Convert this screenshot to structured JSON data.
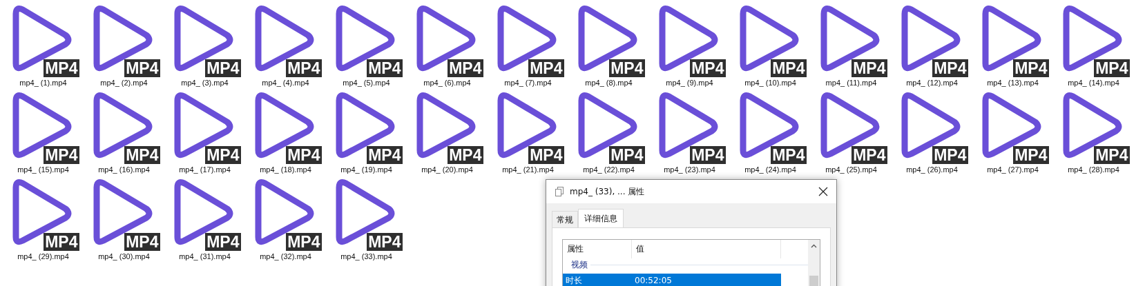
{
  "files": [
    {
      "name": "mp4_ (1).mp4",
      "badge": "MP4"
    },
    {
      "name": "mp4_ (2).mp4",
      "badge": "MP4"
    },
    {
      "name": "mp4_ (3).mp4",
      "badge": "MP4"
    },
    {
      "name": "mp4_ (4).mp4",
      "badge": "MP4"
    },
    {
      "name": "mp4_ (5).mp4",
      "badge": "MP4"
    },
    {
      "name": "mp4_ (6).mp4",
      "badge": "MP4"
    },
    {
      "name": "mp4_ (7).mp4",
      "badge": "MP4"
    },
    {
      "name": "mp4_ (8).mp4",
      "badge": "MP4"
    },
    {
      "name": "mp4_ (9).mp4",
      "badge": "MP4"
    },
    {
      "name": "mp4_ (10).mp4",
      "badge": "MP4"
    },
    {
      "name": "mp4_ (11).mp4",
      "badge": "MP4"
    },
    {
      "name": "mp4_ (12).mp4",
      "badge": "MP4"
    },
    {
      "name": "mp4_ (13).mp4",
      "badge": "MP4"
    },
    {
      "name": "mp4_ (14).mp4",
      "badge": "MP4"
    },
    {
      "name": "mp4_ (15).mp4",
      "badge": "MP4"
    },
    {
      "name": "mp4_ (16).mp4",
      "badge": "MP4"
    },
    {
      "name": "mp4_ (17).mp4",
      "badge": "MP4"
    },
    {
      "name": "mp4_ (18).mp4",
      "badge": "MP4"
    },
    {
      "name": "mp4_ (19).mp4",
      "badge": "MP4"
    },
    {
      "name": "mp4_ (20).mp4",
      "badge": "MP4"
    },
    {
      "name": "mp4_ (21).mp4",
      "badge": "MP4"
    },
    {
      "name": "mp4_ (22).mp4",
      "badge": "MP4"
    },
    {
      "name": "mp4_ (23).mp4",
      "badge": "MP4"
    },
    {
      "name": "mp4_ (24).mp4",
      "badge": "MP4"
    },
    {
      "name": "mp4_ (25).mp4",
      "badge": "MP4"
    },
    {
      "name": "mp4_ (26).mp4",
      "badge": "MP4"
    },
    {
      "name": "mp4_ (27).mp4",
      "badge": "MP4"
    },
    {
      "name": "mp4_ (28).mp4",
      "badge": "MP4"
    },
    {
      "name": "mp4_ (29).mp4",
      "badge": "MP4"
    },
    {
      "name": "mp4_ (30).mp4",
      "badge": "MP4"
    },
    {
      "name": "mp4_ (31).mp4",
      "badge": "MP4"
    },
    {
      "name": "mp4_ (32).mp4",
      "badge": "MP4"
    },
    {
      "name": "mp4_ (33).mp4",
      "badge": "MP4"
    }
  ],
  "dialog": {
    "title": "mp4_ (33), ... 属性",
    "tabs": [
      {
        "label": "常规",
        "selected": false
      },
      {
        "label": "详细信息",
        "selected": true
      }
    ],
    "table": {
      "columns": [
        "属性",
        "值"
      ],
      "rows": [
        {
          "kind": "group",
          "label": "视频"
        },
        {
          "kind": "row",
          "name": "时长",
          "value": "00:52:05",
          "selected": true
        }
      ]
    }
  }
}
